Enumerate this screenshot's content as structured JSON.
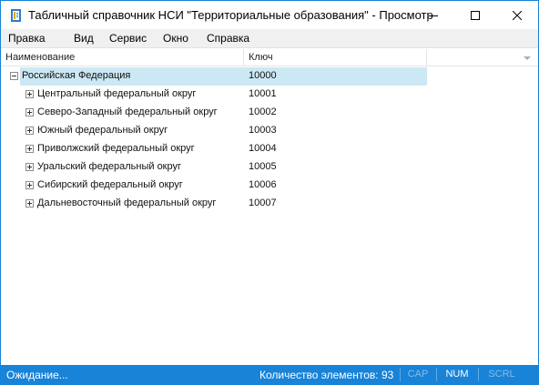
{
  "window": {
    "title": "Табличный справочник НСИ \"Территориальные образования\" - Просмотр"
  },
  "menu": [
    {
      "label": "Правка"
    },
    {
      "label": "Вид"
    },
    {
      "label": "Сервис"
    },
    {
      "label": "Окно"
    },
    {
      "label": "Справка"
    }
  ],
  "columns": {
    "name": "Наименование",
    "key": "Ключ"
  },
  "tree": {
    "root": {
      "label": "Российская Федерация",
      "key": "10000",
      "expanded": true,
      "selected": true
    },
    "children": [
      {
        "label": "Центральный федеральный округ",
        "key": "10001"
      },
      {
        "label": "Северо-Западный федеральный округ",
        "key": "10002"
      },
      {
        "label": "Южный федеральный округ",
        "key": "10003"
      },
      {
        "label": "Приволжский федеральный округ",
        "key": "10004"
      },
      {
        "label": "Уральский федеральный округ",
        "key": "10005"
      },
      {
        "label": "Сибирский федеральный округ",
        "key": "10006"
      },
      {
        "label": "Дальневосточный федеральный округ",
        "key": "10007"
      }
    ]
  },
  "status": {
    "message": "Ожидание...",
    "count": "Количество элементов: 93",
    "cap": "CAP",
    "num": "NUM",
    "scrl": "SCRL"
  },
  "colors": {
    "accent": "#1883d7",
    "selection": "#cce8f4"
  }
}
